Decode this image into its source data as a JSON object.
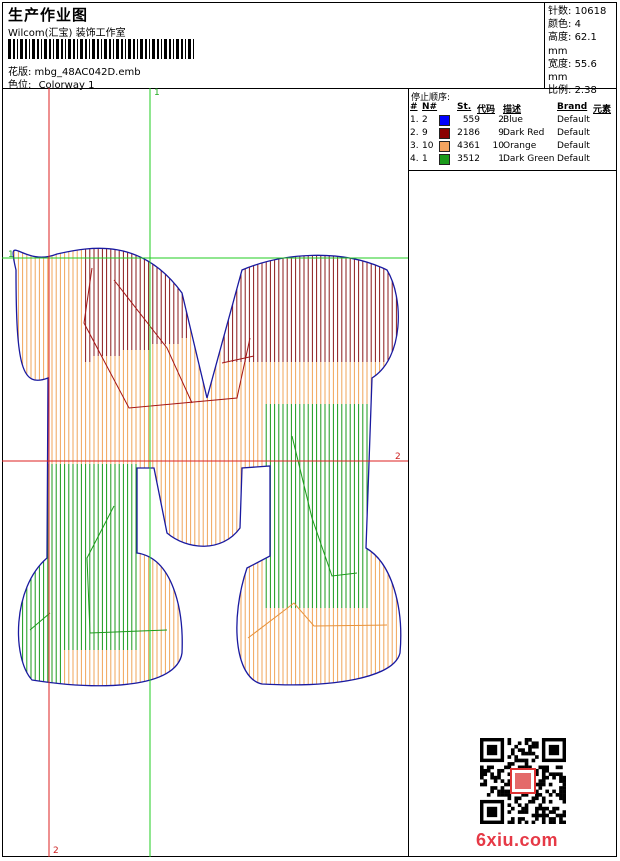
{
  "header": {
    "title": "生产作业图",
    "subtitle": "Wilcom(汇宝) 装饰工作室",
    "design_label": "花版: mbg_48AC042D.emb",
    "colorway_label": "色位:",
    "colorway_value": "Colorway 1"
  },
  "stats": [
    {
      "label": "针数:",
      "value": "10618"
    },
    {
      "label": "颜色:",
      "value": "4"
    },
    {
      "label": "高度:",
      "value": "62.1 mm"
    },
    {
      "label": "宽度:",
      "value": "55.6 mm"
    },
    {
      "label": "比例:",
      "value": "2.38"
    }
  ],
  "sequence": {
    "title": "停止顺序:",
    "columns": [
      "#",
      "N#",
      "St.",
      "代码",
      "描述",
      "Brand",
      "元素"
    ],
    "rows": [
      {
        "index": "1.",
        "n": "2",
        "color": "#0000ff",
        "stitches": "559",
        "code": "2",
        "desc": "Blue",
        "brand": "Default"
      },
      {
        "index": "2.",
        "n": "9",
        "color": "#8b0000",
        "stitches": "2186",
        "code": "9",
        "desc": "Dark Red",
        "brand": "Default"
      },
      {
        "index": "3.",
        "n": "10",
        "color": "#f4a460",
        "stitches": "4361",
        "code": "10",
        "desc": "Orange",
        "brand": "Default"
      },
      {
        "index": "4.",
        "n": "1",
        "color": "#1a9a1a",
        "stitches": "3512",
        "code": "1",
        "desc": "Dark Green",
        "brand": "Default"
      }
    ]
  },
  "axes": {
    "top_green": "1",
    "left_green": "1",
    "right_red": "2",
    "bottom_red": "2"
  },
  "watermark": "6xiu.com"
}
